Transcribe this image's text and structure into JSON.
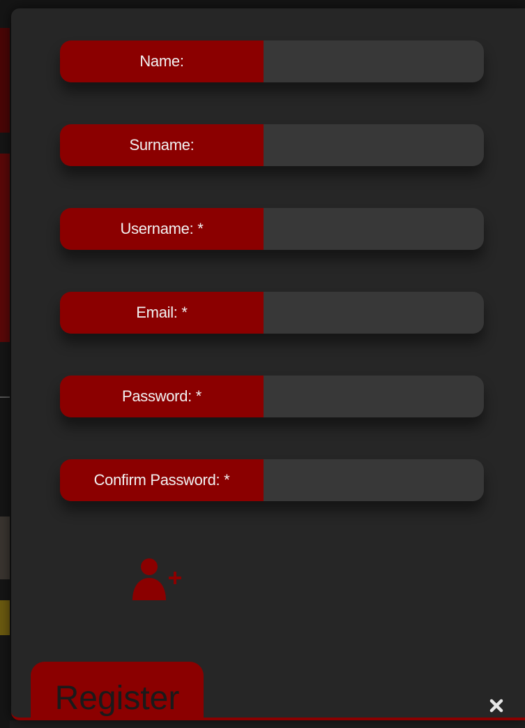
{
  "form": {
    "fields": [
      {
        "label": "Name:",
        "value": "",
        "required": false
      },
      {
        "label": "Surname:",
        "value": "",
        "required": false
      },
      {
        "label": "Username: *",
        "value": "",
        "required": true
      },
      {
        "label": "Email: *",
        "value": "",
        "required": true
      },
      {
        "label": "Password: *",
        "value": "",
        "required": true
      },
      {
        "label": "Confirm Password: *",
        "value": "",
        "required": true
      }
    ]
  },
  "icons": {
    "add_user": "user-plus-icon",
    "close": "close-icon"
  },
  "modal": {
    "title": "Register"
  },
  "colors": {
    "accent": "#8b0000",
    "modal_bg": "#262626",
    "input_bg": "#383838",
    "label_text": "#f2f2f2"
  }
}
